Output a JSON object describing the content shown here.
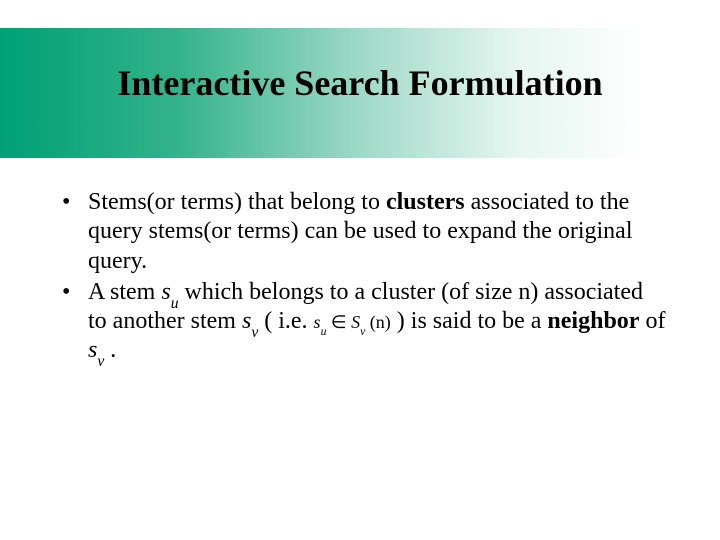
{
  "title": "Interactive Search Formulation",
  "bullets": [
    {
      "pre": "Stems(or terms) that belong to ",
      "bold1": "clusters",
      "post": " associated to the query stems(or terms) can be used to expand the original query."
    },
    {
      "t1": "A stem ",
      "su_sym": "s",
      "su_sub": "u",
      "t2": " which belongs to a cluster (of size n) associated to another stem ",
      "sv_sym": "s",
      "sv_sub": "v",
      "t3": " ( i.e. ",
      "math_su_sym": "s",
      "math_su_sub": "u",
      "math_in": " ∈ ",
      "math_Sv_sym": "S",
      "math_Sv_sub": "v",
      "math_arg": " (n)",
      "t4": "  ) is said to be a ",
      "bold2": "neighbor",
      "t5": " of ",
      "sv2_sym": "s",
      "sv2_sub": "v",
      "t6": " ."
    }
  ]
}
